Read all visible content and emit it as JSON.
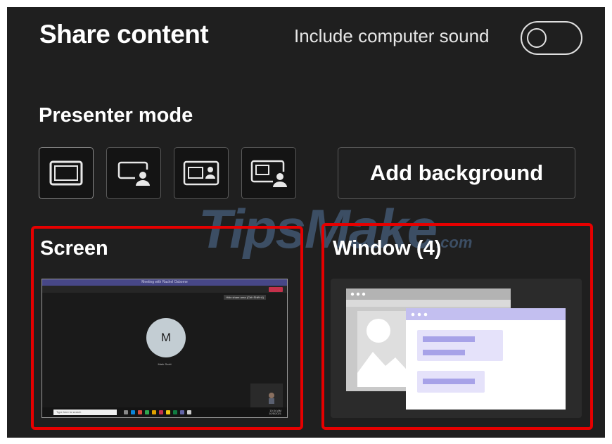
{
  "header": {
    "title": "Share content",
    "sound_label": "Include computer sound",
    "sound_enabled": false
  },
  "presenter": {
    "label": "Presenter mode",
    "modes": [
      {
        "icon": "content-only-icon",
        "active": true
      },
      {
        "icon": "standout-icon",
        "active": false
      },
      {
        "icon": "side-by-side-icon",
        "active": false
      },
      {
        "icon": "reporter-icon",
        "active": false
      }
    ],
    "add_background_label": "Add background"
  },
  "watermark": {
    "main": "TipsMake",
    "suffix": ".com"
  },
  "screen": {
    "label": "Screen",
    "preview": {
      "title": "Meeting with Rachel Osborne",
      "avatar_initial": "M",
      "participant": "Mark Scott",
      "tooltip": "Hide share area (Ctrl+Shift+A)",
      "search_placeholder": "Type here to search",
      "time": "10:34 AM",
      "date": "10/5/2021"
    }
  },
  "window": {
    "label": "Window (4)"
  },
  "colors": {
    "panel_bg": "#1f1f1f",
    "highlight": "#e60000",
    "teams_purple": "#474787",
    "window_header": "#c3bff0",
    "window_item": "#e5e2fa",
    "window_bar": "#a7a2e8"
  }
}
